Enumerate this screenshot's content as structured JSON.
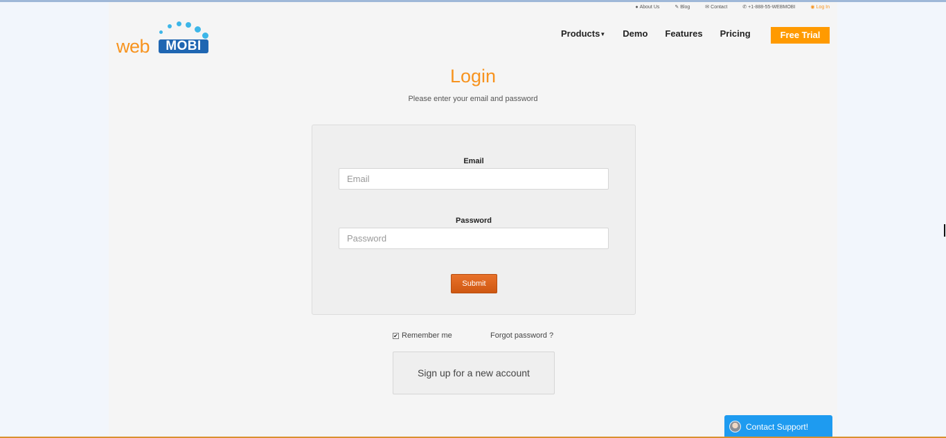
{
  "utility_bar": {
    "about": "About Us",
    "blog": "Blog",
    "contact": "Contact",
    "phone": "+1-888-55-WEBMOBI",
    "login": "Log In"
  },
  "logo": {
    "part1": "web",
    "part2": "MOBI"
  },
  "nav": {
    "products": "Products",
    "demo": "Demo",
    "features": "Features",
    "pricing": "Pricing",
    "free_trial": "Free Trial"
  },
  "login": {
    "title": "Login",
    "subtitle": "Please enter your email and password",
    "email_label": "Email",
    "email_placeholder": "Email",
    "password_label": "Password",
    "password_placeholder": "Password",
    "submit": "Submit",
    "remember": "Remember me",
    "remember_checked": true,
    "forgot": "Forgot password ?",
    "signup": "Sign up for a new account"
  },
  "support": {
    "label": "Contact Support!"
  },
  "colors": {
    "accent": "#f7931e",
    "brand_blue": "#1f66b2",
    "submit": "#e0651f",
    "support": "#1e9bf0"
  }
}
